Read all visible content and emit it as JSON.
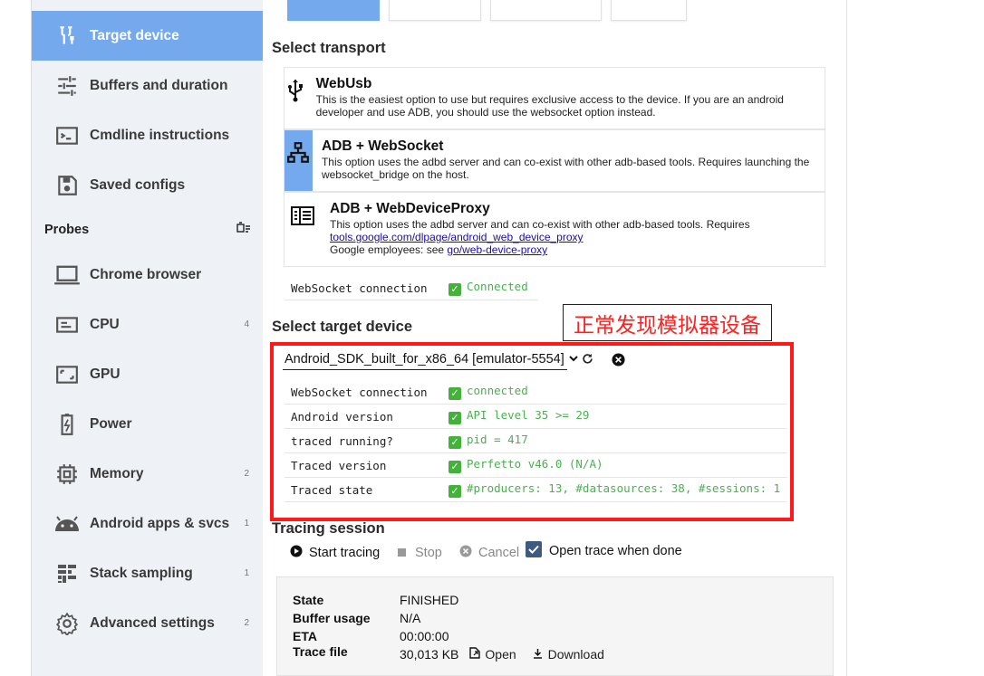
{
  "sidebar": {
    "items": [
      {
        "label": "Target device",
        "icon": "usb-plug-icon",
        "count": ""
      },
      {
        "label": "Buffers and duration",
        "icon": "sliders-icon",
        "count": ""
      },
      {
        "label": "Cmdline instructions",
        "icon": "terminal-icon",
        "count": ""
      },
      {
        "label": "Saved configs",
        "icon": "save-icon",
        "count": ""
      }
    ],
    "probes_title": "Probes",
    "probes": [
      {
        "label": "Chrome browser",
        "icon": "laptop-icon",
        "count": ""
      },
      {
        "label": "CPU",
        "icon": "cpu-icon",
        "count": "4"
      },
      {
        "label": "GPU",
        "icon": "gpu-icon",
        "count": ""
      },
      {
        "label": "Power",
        "icon": "battery-icon",
        "count": ""
      },
      {
        "label": "Memory",
        "icon": "memory-icon",
        "count": "2"
      },
      {
        "label": "Android apps & svcs",
        "icon": "android-icon",
        "count": "1"
      },
      {
        "label": "Stack sampling",
        "icon": "stack-icon",
        "count": "1"
      },
      {
        "label": "Advanced settings",
        "icon": "gear-icon",
        "count": "2"
      }
    ]
  },
  "transport": {
    "heading": "Select transport",
    "options": [
      {
        "title": "WebUsb",
        "desc": "This is the easiest option to use but requires exclusive access to the device. If you are an android developer and use ADB, you should use the websocket option instead."
      },
      {
        "title": "ADB + WebSocket",
        "desc": "This option uses the adbd server and can co-exist with other adb-based tools. Requires launching the websocket_bridge on the host."
      },
      {
        "title": "ADB + WebDeviceProxy",
        "desc": "This option uses the adbd server and can co-exist with other adb-based tools. Requires",
        "link": "tools.google.com/dlpage/android_web_device_proxy",
        "note_prefix": "Google employees: see ",
        "note_link": "go/web-device-proxy"
      }
    ],
    "ws_label": "WebSocket connection",
    "ws_value": "Connected"
  },
  "target": {
    "heading": "Select target device",
    "selected_device": "Android_SDK_built_for_x86_64 [emulator-5554]",
    "annotation": "正常发现模拟器设备",
    "status": [
      {
        "key": "WebSocket connection",
        "value": "connected"
      },
      {
        "key": "Android version",
        "value": "API level 35 >= 29"
      },
      {
        "key": "traced running?",
        "value": "pid = 417"
      },
      {
        "key": "Traced version",
        "value": "Perfetto v46.0 (N/A)"
      },
      {
        "key": "Traced state",
        "value": "#producers: 13, #datasources: 38, #sessions: 1"
      }
    ]
  },
  "session": {
    "heading": "Tracing session",
    "start": "Start tracing",
    "stop": "Stop",
    "cancel": "Cancel",
    "open_when_done": "Open trace when done",
    "state_label": "State",
    "state": "FINISHED",
    "buffer_label": "Buffer usage",
    "buffer": "N/A",
    "eta_label": "ETA",
    "eta": "00:00:00",
    "file_label": "Trace file",
    "file_size": "30,013 KB",
    "open": "Open",
    "download": "Download"
  },
  "colors": {
    "accent": "#74a9ee",
    "ok": "#44b23a",
    "annotation_red": "#ff1a1a"
  }
}
